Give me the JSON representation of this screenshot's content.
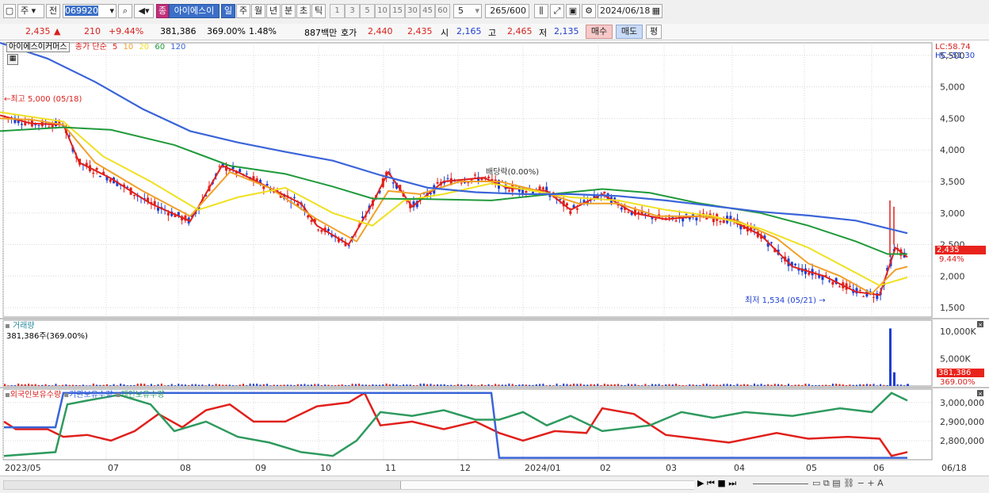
{
  "toolbar": {
    "period_mode": "주",
    "prev_label": "전",
    "stock_code": "069920",
    "stock_name_badge": "종",
    "stock_name": "아이에스이",
    "periods": [
      "일",
      "주",
      "월",
      "년",
      "분",
      "초",
      "틱"
    ],
    "active_period": "일",
    "intervals": [
      "1",
      "3",
      "5",
      "10",
      "15",
      "30",
      "45",
      "60"
    ],
    "interval_value": "5",
    "count_display": "265",
    "count_total": "/600",
    "date": "2024/06/18"
  },
  "quote": {
    "price": "2,435",
    "change_arrow": "▲",
    "change": "210",
    "change_pct": "+9.44%",
    "volume": "381,386",
    "volume_ratio": "369.00%",
    "turnover": "1.48%",
    "amount": "887백만",
    "bid_label": "호가",
    "ask": "2,440",
    "bid": "2,435",
    "open_label": "시",
    "open": "2,165",
    "high_label": "고",
    "high": "2,465",
    "low_label": "저",
    "low": "2,135",
    "buy_button": "매수",
    "sell_button": "매도",
    "eval_button": "평"
  },
  "main_legend": {
    "name": "아이에스이커머스",
    "ma_label": "종가 단순",
    "ma": [
      {
        "period": "5",
        "color": "#e0201c"
      },
      {
        "period": "10",
        "color": "#f0a028"
      },
      {
        "period": "20",
        "color": "#f0e020"
      },
      {
        "period": "60",
        "color": "#1f9a3a"
      },
      {
        "period": "120",
        "color": "#3a64d8"
      }
    ],
    "lc": "LC:58.74",
    "hc": "HC:-51.30"
  },
  "annotations": {
    "high": "최고 5,000 (05/18)",
    "low": "최저 1,534 (05/21)",
    "ex_dividend": "배당락(0.00%)"
  },
  "price_chip": {
    "price": "2,435",
    "pct": "9.44%"
  },
  "volume_panel": {
    "title": "거래량",
    "value": "381,386주(369.00%)",
    "chip_value": "381,386",
    "chip_pct": "369.00%"
  },
  "holder_panel": {
    "series": [
      "외국인보유수량",
      "기관보유수량",
      "개인보유수량"
    ]
  },
  "colors": {
    "up": "#e0201c",
    "down": "#1f3fd1",
    "ma5": "#e0201c",
    "ma10": "#f0a028",
    "ma20": "#f0e020",
    "ma60": "#1f9a3a",
    "ma120": "#3a64d8",
    "foreign": "#e0201c",
    "inst": "#3a64d8",
    "retail": "#2e9a5e"
  },
  "chart_data": [
    {
      "type": "line",
      "title": "아이에스이커머스",
      "y_ticks": [
        "5,500",
        "5,000",
        "4,500",
        "4,000",
        "3,500",
        "3,000",
        "2,500",
        "2,000",
        "1,500"
      ],
      "ylim": [
        1350,
        5700
      ],
      "x_labels": [
        "2023/05",
        "07",
        "08",
        "09",
        "10",
        "11",
        "12",
        "2024/01",
        "02",
        "03",
        "04",
        "05",
        "06",
        "06/18"
      ],
      "series": [
        {
          "name": "5",
          "points": [
            [
              0,
              4550
            ],
            [
              40,
              4420
            ],
            [
              80,
              4400
            ],
            [
              100,
              3800
            ],
            [
              140,
              3550
            ],
            [
              190,
              3150
            ],
            [
              240,
              2870
            ],
            [
              280,
              3750
            ],
            [
              300,
              3650
            ],
            [
              340,
              3400
            ],
            [
              380,
              3150
            ],
            [
              400,
              2800
            ],
            [
              440,
              2500
            ],
            [
              470,
              3150
            ],
            [
              490,
              3650
            ],
            [
              520,
              3100
            ],
            [
              560,
              3500
            ],
            [
              610,
              3560
            ],
            [
              640,
              3400
            ],
            [
              690,
              3350
            ],
            [
              720,
              3050
            ],
            [
              760,
              3300
            ],
            [
              800,
              3000
            ],
            [
              840,
              2900
            ],
            [
              880,
              2950
            ],
            [
              920,
              2900
            ],
            [
              960,
              2650
            ],
            [
              1000,
              2150
            ],
            [
              1040,
              2000
            ],
            [
              1080,
              1750
            ],
            [
              1110,
              1700
            ],
            [
              1130,
              2450
            ],
            [
              1145,
              2300
            ]
          ]
        },
        {
          "name": "10",
          "points": [
            [
              0,
              4500
            ],
            [
              40,
              4480
            ],
            [
              80,
              4400
            ],
            [
              120,
              3800
            ],
            [
              180,
              3350
            ],
            [
              240,
              2950
            ],
            [
              290,
              3650
            ],
            [
              340,
              3400
            ],
            [
              400,
              2900
            ],
            [
              450,
              2550
            ],
            [
              490,
              3350
            ],
            [
              530,
              3300
            ],
            [
              580,
              3500
            ],
            [
              630,
              3500
            ],
            [
              680,
              3350
            ],
            [
              730,
              3150
            ],
            [
              780,
              3150
            ],
            [
              830,
              2950
            ],
            [
              880,
              2950
            ],
            [
              930,
              2880
            ],
            [
              980,
              2600
            ],
            [
              1020,
              2200
            ],
            [
              1060,
              2000
            ],
            [
              1100,
              1720
            ],
            [
              1130,
              2100
            ],
            [
              1145,
              2150
            ]
          ]
        },
        {
          "name": "20",
          "points": [
            [
              0,
              4600
            ],
            [
              80,
              4450
            ],
            [
              130,
              3900
            ],
            [
              190,
              3500
            ],
            [
              250,
              3050
            ],
            [
              300,
              3250
            ],
            [
              360,
              3400
            ],
            [
              420,
              3000
            ],
            [
              470,
              2800
            ],
            [
              510,
              3200
            ],
            [
              560,
              3300
            ],
            [
              620,
              3470
            ],
            [
              660,
              3380
            ],
            [
              720,
              3250
            ],
            [
              780,
              3200
            ],
            [
              840,
              3050
            ],
            [
              900,
              2950
            ],
            [
              960,
              2750
            ],
            [
              1020,
              2450
            ],
            [
              1080,
              2050
            ],
            [
              1110,
              1850
            ],
            [
              1145,
              1980
            ]
          ]
        },
        {
          "name": "60",
          "points": [
            [
              0,
              4300
            ],
            [
              80,
              4360
            ],
            [
              140,
              4320
            ],
            [
              220,
              4080
            ],
            [
              290,
              3750
            ],
            [
              360,
              3620
            ],
            [
              420,
              3420
            ],
            [
              470,
              3230
            ],
            [
              540,
              3220
            ],
            [
              620,
              3200
            ],
            [
              680,
              3280
            ],
            [
              760,
              3380
            ],
            [
              820,
              3320
            ],
            [
              880,
              3160
            ],
            [
              960,
              3000
            ],
            [
              1020,
              2800
            ],
            [
              1080,
              2550
            ],
            [
              1120,
              2350
            ],
            [
              1145,
              2350
            ]
          ]
        },
        {
          "name": "120",
          "points": [
            [
              0,
              5700
            ],
            [
              60,
              5450
            ],
            [
              120,
              5080
            ],
            [
              180,
              4650
            ],
            [
              240,
              4300
            ],
            [
              300,
              4120
            ],
            [
              360,
              3970
            ],
            [
              420,
              3830
            ],
            [
              480,
              3600
            ],
            [
              540,
              3400
            ],
            [
              600,
              3330
            ],
            [
              660,
              3300
            ],
            [
              720,
              3300
            ],
            [
              780,
              3270
            ],
            [
              840,
              3200
            ],
            [
              900,
              3110
            ],
            [
              960,
              3020
            ],
            [
              1020,
              2960
            ],
            [
              1080,
              2880
            ],
            [
              1145,
              2680
            ]
          ]
        }
      ]
    },
    {
      "type": "bar",
      "title": "거래량",
      "y_ticks": [
        "10,000K",
        "5,000K"
      ],
      "ylim": [
        0,
        12000
      ],
      "spikes": [
        {
          "x": 1123,
          "value": 10500
        },
        {
          "x": 1128,
          "value": 2500
        },
        {
          "x": 1145,
          "value": 381
        }
      ]
    },
    {
      "type": "line",
      "y_ticks": [
        "3,000,000",
        "2,900,000",
        "2,800,000"
      ],
      "series": [
        {
          "name": "외국인보유수량",
          "points": [
            [
              5,
              2900000
            ],
            [
              20,
              2860000
            ],
            [
              60,
              2860000
            ],
            [
              80,
              2820000
            ],
            [
              110,
              2830000
            ],
            [
              140,
              2800000
            ],
            [
              170,
              2850000
            ],
            [
              200,
              2940000
            ],
            [
              230,
              2870000
            ],
            [
              260,
              2960000
            ],
            [
              290,
              2990000
            ],
            [
              320,
              2900000
            ],
            [
              360,
              2900000
            ],
            [
              400,
              2980000
            ],
            [
              440,
              3000000
            ],
            [
              460,
              3050000
            ],
            [
              480,
              2880000
            ],
            [
              520,
              2900000
            ],
            [
              560,
              2860000
            ],
            [
              600,
              2900000
            ],
            [
              630,
              2840000
            ],
            [
              660,
              2800000
            ],
            [
              700,
              2850000
            ],
            [
              740,
              2840000
            ],
            [
              760,
              2970000
            ],
            [
              800,
              2940000
            ],
            [
              840,
              2830000
            ],
            [
              880,
              2810000
            ],
            [
              920,
              2790000
            ],
            [
              980,
              2840000
            ],
            [
              1020,
              2810000
            ],
            [
              1070,
              2820000
            ],
            [
              1110,
              2810000
            ],
            [
              1125,
              2720000
            ],
            [
              1145,
              2740000
            ]
          ]
        },
        {
          "name": "기관보유수량",
          "points": [
            [
              5,
              2870000
            ],
            [
              70,
              2870000
            ],
            [
              80,
              3050000
            ],
            [
              620,
              3050000
            ],
            [
              630,
              2710000
            ],
            [
              1145,
              2710000
            ]
          ]
        },
        {
          "name": "개인보유수량",
          "points": [
            [
              5,
              2720000
            ],
            [
              70,
              2740000
            ],
            [
              85,
              2990000
            ],
            [
              110,
              3010000
            ],
            [
              150,
              3040000
            ],
            [
              190,
              2990000
            ],
            [
              220,
              2850000
            ],
            [
              260,
              2900000
            ],
            [
              300,
              2820000
            ],
            [
              340,
              2790000
            ],
            [
              380,
              2740000
            ],
            [
              420,
              2720000
            ],
            [
              450,
              2800000
            ],
            [
              480,
              2950000
            ],
            [
              520,
              2930000
            ],
            [
              560,
              2960000
            ],
            [
              600,
              2910000
            ],
            [
              630,
              2910000
            ],
            [
              660,
              2950000
            ],
            [
              690,
              2880000
            ],
            [
              720,
              2930000
            ],
            [
              760,
              2850000
            ],
            [
              820,
              2880000
            ],
            [
              860,
              2950000
            ],
            [
              900,
              2920000
            ],
            [
              940,
              2950000
            ],
            [
              1000,
              2930000
            ],
            [
              1060,
              2970000
            ],
            [
              1100,
              2950000
            ],
            [
              1125,
              3050000
            ],
            [
              1145,
              3010000
            ]
          ]
        }
      ]
    }
  ]
}
